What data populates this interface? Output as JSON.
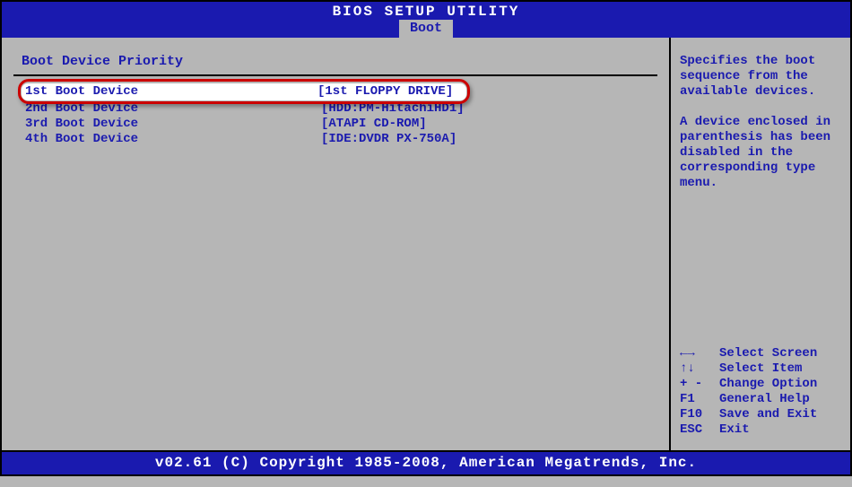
{
  "title": "BIOS SETUP UTILITY",
  "tab": "Boot",
  "section_title": "Boot Device Priority",
  "boot_devices": {
    "d1": {
      "label": "1st Boot Device",
      "value": "[1st FLOPPY DRIVE]"
    },
    "d2": {
      "label": "2nd Boot Device",
      "value": "[HDD:PM-HitachiHD1]"
    },
    "d3": {
      "label": "3rd Boot Device",
      "value": "[ATAPI CD-ROM]"
    },
    "d4": {
      "label": "4th Boot Device",
      "value": "[IDE:DVDR PX-750A]"
    }
  },
  "help": {
    "line1": "Specifies the boot sequence from the available devices.",
    "line2": "A device enclosed in parenthesis has been disabled in the corresponding type menu."
  },
  "keys": {
    "k1": {
      "key": "←→",
      "label": "Select Screen"
    },
    "k2": {
      "key": "↑↓",
      "label": "Select Item"
    },
    "k3": {
      "key": "+ -",
      "label": "Change Option"
    },
    "k4": {
      "key": "F1",
      "label": "General Help"
    },
    "k5": {
      "key": "F10",
      "label": "Save and Exit"
    },
    "k6": {
      "key": "ESC",
      "label": "Exit"
    }
  },
  "footer": "v02.61 (C) Copyright 1985-2008, American Megatrends, Inc."
}
